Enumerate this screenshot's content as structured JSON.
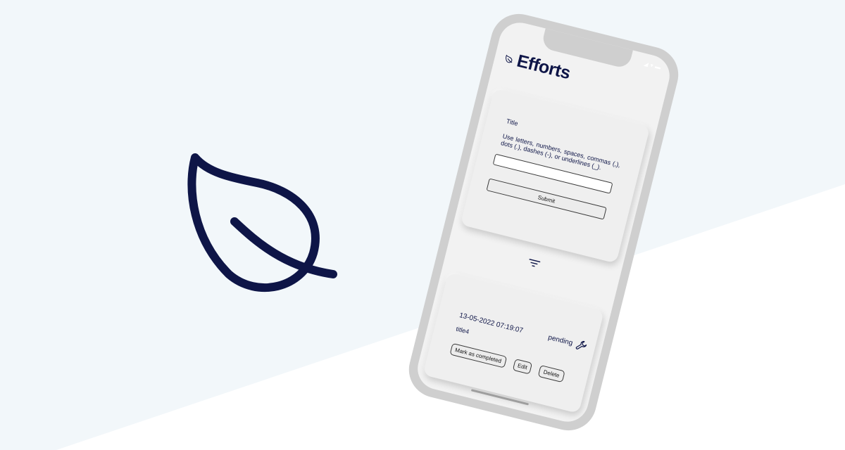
{
  "colors": {
    "bg_light": "#f2f7fa",
    "bg_white": "#ffffff",
    "navy": "#0e1547",
    "phone_frame": "#cfcfcf",
    "screen": "#f2f2f2"
  },
  "app": {
    "title": "Efforts",
    "logo_icon": "leaf-icon"
  },
  "form": {
    "label": "Title",
    "hint": "Use letters, numbers, spaces, commas (,), dots (.), dashes (-), or underlines (_).",
    "input_value": "",
    "submit_label": "Submit"
  },
  "filter": {
    "icon": "filter-icon"
  },
  "item": {
    "date": "13-05-2022 07:19:07",
    "status": "pending",
    "status_icon": "wrench-icon",
    "title": "title4",
    "mark_completed_label": "Mark as completed",
    "edit_label": "Edit",
    "delete_label": "Delete"
  }
}
